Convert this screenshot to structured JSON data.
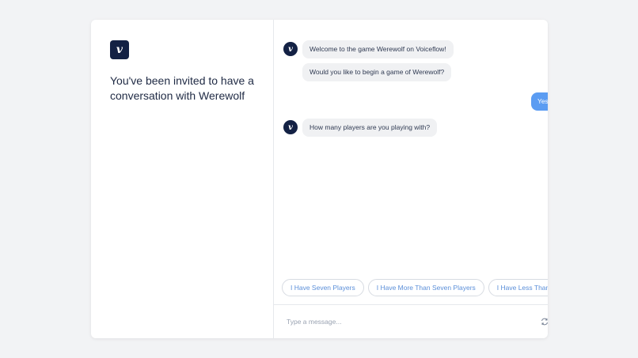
{
  "brand": {
    "logo_glyph": "v",
    "accent": "#5b9cf2",
    "dark": "#132144"
  },
  "left": {
    "invite_text": "You've been invited to have a conversation with Werewolf"
  },
  "messages": {
    "group1": [
      "Welcome to the game Werewolf on Voiceflow!",
      "Would you like to begin a game of Werewolf?"
    ],
    "user1": "Yes start a game",
    "group2": [
      "How many players are you playing with?"
    ]
  },
  "chips": [
    "I Have Seven Players",
    "I Have More Than Seven Players",
    "I Have Less Than Seven Players"
  ],
  "composer": {
    "placeholder": "Type a message...",
    "icons": [
      "refresh-icon",
      "speaker-icon",
      "send-icon"
    ]
  }
}
